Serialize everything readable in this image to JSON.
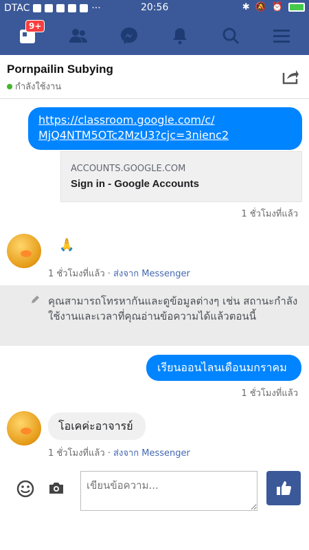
{
  "statusbar": {
    "carrier": "DTAC",
    "time": "20:56"
  },
  "nav": {
    "notification_badge": "9+"
  },
  "chat": {
    "contact_name": "Pornpailin Subying",
    "contact_status": "กำลังใช้งาน"
  },
  "messages": {
    "link_url_line1": "https://classroom.google.com/c/",
    "link_url_line2": "MjQ4NTM5OTc2MzU3?cjc=3nienc2",
    "link_domain": "ACCOUNTS.GOOGLE.COM",
    "link_title": "Sign in - Google Accounts",
    "time_1": "1 ชั่วโมงที่แล้ว",
    "in_emoji": "🙏",
    "time_2": "1 ชั่วโมงที่แล้ว",
    "time_2_sep": " · ",
    "time_2_source": "ส่งจาก Messenger",
    "notice": "คุณสามารถโทรหากันและดูข้อมูลต่างๆ เช่น สถานะกำลังใช้งานและเวลาที่คุณอ่านข้อความได้แล้วตอนนี้",
    "out_text": "เรียนออนไลนเดือนมกราคม",
    "time_3": "1 ชั่วโมงที่แล้ว",
    "in_text": "โอเคค่ะอาจารย์",
    "time_4": "1 ชั่วโมงที่แล้ว",
    "time_4_sep": " · ",
    "time_4_source": "ส่งจาก Messenger"
  },
  "composer": {
    "placeholder": "เขียนข้อความ..."
  },
  "colors": {
    "brand": "#3b5998",
    "bubble_out": "#0084ff",
    "online": "#42b72a"
  }
}
